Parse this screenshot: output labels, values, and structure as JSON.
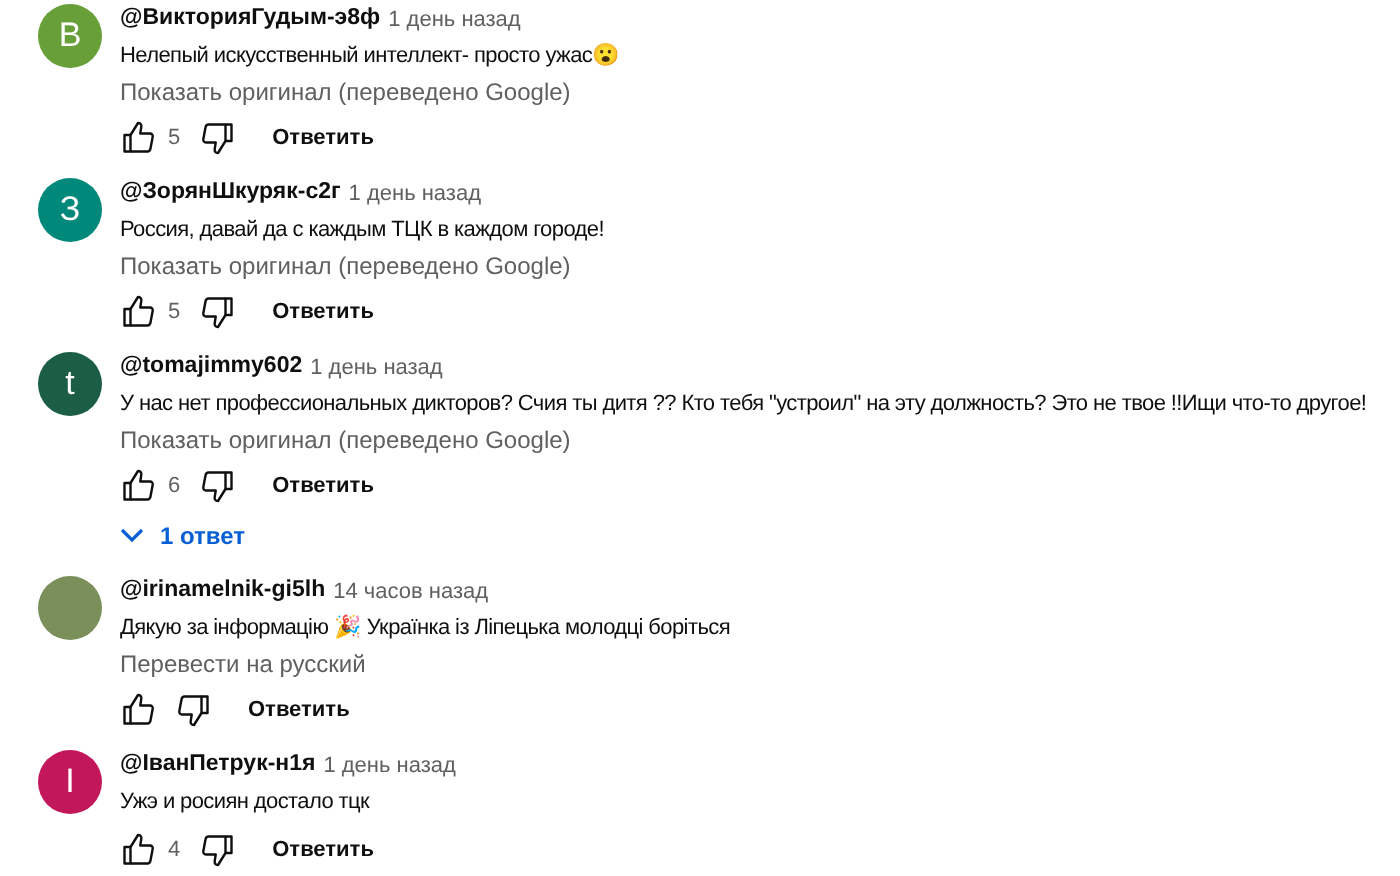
{
  "comments": [
    {
      "avatar": {
        "kind": "letter",
        "letter": "В",
        "color": "#689f38"
      },
      "author": "@ВикторияГудым-э8ф",
      "time": "1 день назад",
      "text": "Нелепый искусственный интеллект- просто ужас😮",
      "translate_link": "Показать оригинал (переведено Google)",
      "likes": "5",
      "reply_button": "Ответить"
    },
    {
      "avatar": {
        "kind": "letter",
        "letter": "З",
        "color": "#00897b"
      },
      "author": "@ЗорянШкуряк-с2г",
      "time": "1 день назад",
      "text": "Россия, давай да с каждым ТЦК в каждом городе!",
      "translate_link": "Показать оригинал (переведено Google)",
      "likes": "5",
      "reply_button": "Ответить"
    },
    {
      "avatar": {
        "kind": "letter",
        "letter": "t",
        "color": "#1b5e45"
      },
      "author": "@tomajimmy602",
      "time": "1 день назад",
      "text": "У нас нет профессиональных дикторов? Счия ты дитя ?? Кто тебя \"устроил\" на эту должность? Это не твое !!Ищи что-то другое!",
      "translate_link": "Показать оригинал (переведено Google)",
      "likes": "6",
      "reply_button": "Ответить",
      "replies_toggle": "1 ответ"
    },
    {
      "avatar": {
        "kind": "photo"
      },
      "author": "@irinamelnik-gi5lh",
      "time": "14 часов назад",
      "text": "Дякую за інформацію 🎉 Українка із Ліпецька молодці боріться",
      "translate_link": "Перевести на русский",
      "reply_button": "Ответить"
    },
    {
      "avatar": {
        "kind": "letter",
        "letter": "I",
        "color": "#c2185b"
      },
      "author": "@IванПетрук-н1я",
      "time": "1 день назад",
      "text": "Ужэ и росиян достало тцк",
      "likes": "4",
      "reply_button": "Ответить"
    }
  ]
}
